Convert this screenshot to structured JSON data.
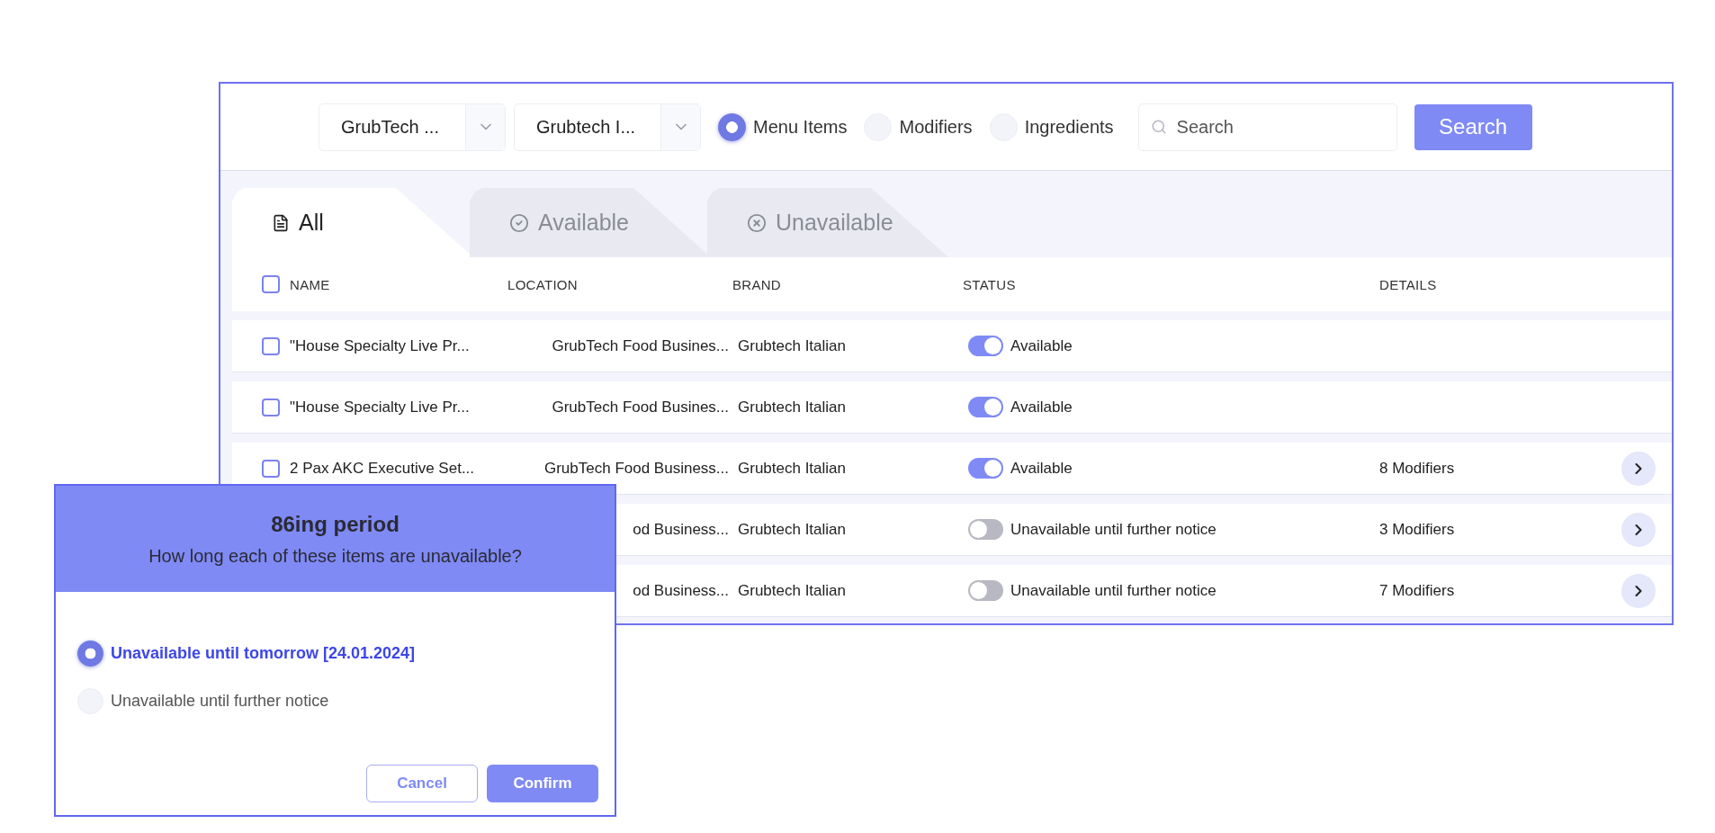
{
  "filters": {
    "dropdowns": [
      {
        "value": "GrubTech ..."
      },
      {
        "value": "Grubtech I..."
      }
    ],
    "radios": [
      {
        "label": "Menu Items",
        "selected": true
      },
      {
        "label": "Modifiers",
        "selected": false
      },
      {
        "label": "Ingredients",
        "selected": false
      }
    ],
    "search": {
      "placeholder": "Search"
    },
    "search_button": "Search"
  },
  "tabs": [
    {
      "label": "All",
      "kind": "all",
      "selected": true
    },
    {
      "label": "Available",
      "kind": "available",
      "selected": false
    },
    {
      "label": "Unavailable",
      "kind": "unavailable",
      "selected": false
    }
  ],
  "table": {
    "header_checked": false,
    "columns": [
      "NAME",
      "LOCATION",
      "BRAND",
      "STATUS",
      "DETAILS"
    ],
    "rows": [
      {
        "checked": false,
        "name": "\"House Specialty Live Pr...",
        "location": "GrubTech Food Busines...",
        "brand": "Grubtech Italian",
        "status": {
          "on": true,
          "label": "Available"
        }
      },
      {
        "checked": false,
        "name": "\"House Specialty Live Pr...",
        "location": "GrubTech Food Busines...",
        "brand": "Grubtech Italian",
        "status": {
          "on": true,
          "label": "Available"
        }
      },
      {
        "checked": false,
        "name": "2 Pax AKC Executive Set...",
        "location": "GrubTech Food Business...",
        "brand": "Grubtech Italian",
        "status": {
          "on": true,
          "label": "Available"
        },
        "details": "8 Modifiers"
      },
      {
        "location": "od Business...",
        "brand": "Grubtech Italian",
        "status": {
          "on": false,
          "label": "Unavailable until further notice"
        },
        "details": "3 Modifiers"
      },
      {
        "location": "od Business...",
        "brand": "Grubtech Italian",
        "status": {
          "on": false,
          "label": "Unavailable until further notice"
        },
        "details": "7 Modifiers"
      }
    ]
  },
  "dialog": {
    "title": "86ing period",
    "subtitle": "How long each of these items are unavailable?",
    "options": [
      {
        "label": "Unavailable until tomorrow [24.01.2024]",
        "selected": true
      },
      {
        "label": "Unavailable until further notice",
        "selected": false
      }
    ],
    "buttons": [
      {
        "label": "Cancel",
        "kind": "secondary"
      },
      {
        "label": "Confirm",
        "kind": "primary"
      }
    ]
  }
}
